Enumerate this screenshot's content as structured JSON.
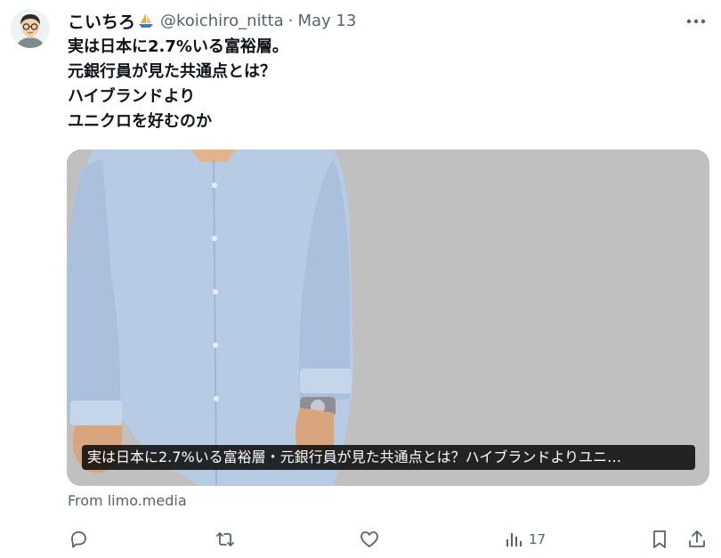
{
  "tweet": {
    "display_name": "こいちろ",
    "badge_icon": "sailboat-icon",
    "handle": "@koichiro_nitta",
    "separator": "·",
    "date": "May 13",
    "lines": [
      "実は日本に2.7%いる富裕層。",
      "元銀行員が見た共通点とは？",
      "ハイブランドより",
      "ユニクロを好むのか"
    ]
  },
  "card": {
    "title": "実は日本に2.7%いる富裕層・元銀行員が見た共通点とは？ハイブランドよりユニ…",
    "source": "From limo.media"
  },
  "actions": {
    "reply_icon": "reply-icon",
    "retweet_icon": "retweet-icon",
    "like_icon": "heart-icon",
    "views_icon": "bar-chart-icon",
    "views_count": "17",
    "bookmark_icon": "bookmark-icon",
    "share_icon": "share-icon"
  },
  "colors": {
    "text": "#0f1419",
    "secondary": "#536471",
    "card_bg": "#c0c0c0",
    "shirt": "#b7cce4"
  }
}
